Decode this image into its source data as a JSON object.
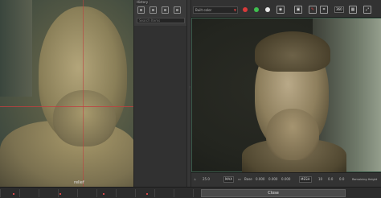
{
  "left_viewport": {
    "label": "relief"
  },
  "layers_panel": {
    "tab_label": "History",
    "search_placeholder": "Search Items",
    "icons": [
      "export-icon",
      "import-icon",
      "save-icon",
      "delete-icon"
    ]
  },
  "toolbar": {
    "material_select": "Built color",
    "color_dots": [
      "#d83a3a",
      "#3fbf4f",
      "#e6e6e6"
    ],
    "icons": [
      "camera-icon",
      "floppy-icon",
      "paint-icon",
      "crop-icon"
    ],
    "badge": "360",
    "icons2": [
      "grid-icon",
      "fullscreen-icon"
    ]
  },
  "statusbar": {
    "zoom": "25.0",
    "unit": "MAX",
    "scale_label": "Base",
    "values": [
      "0.000",
      "0.000",
      "0.000"
    ],
    "mode": "MESH",
    "extras": [
      "10",
      "0.0",
      "0.0"
    ],
    "tail": "Remaining Height"
  },
  "bottom": {
    "close_label": "Close"
  }
}
